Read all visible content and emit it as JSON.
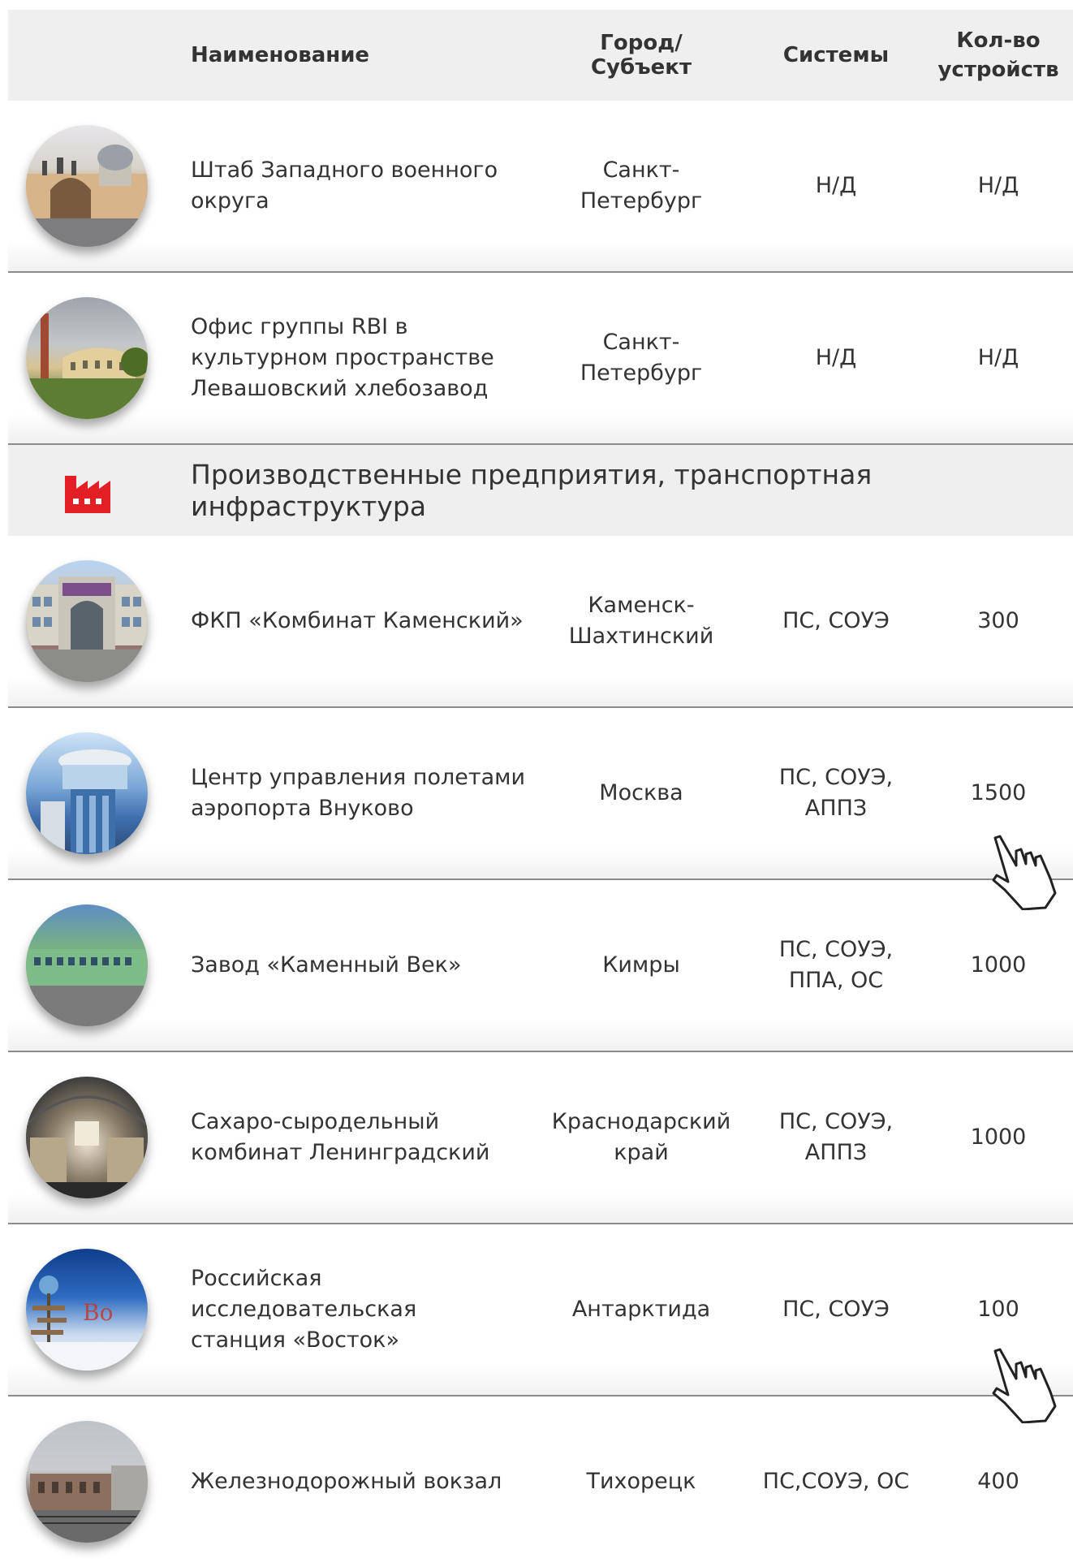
{
  "header": {
    "name": "Наименование",
    "city": "Город/Субъект",
    "systems": "Системы",
    "count_line1": "Кол-во",
    "count_line2": "устройств"
  },
  "rows_top": [
    {
      "name": "Штаб Западного военного округа",
      "city": "Санкт-Петербург",
      "systems": "Н/Д",
      "count": "Н/Д"
    },
    {
      "name_lines": [
        "Офис группы RBI в",
        "культурном пространстве",
        "Левашовский хлебозавод"
      ],
      "city": "Санкт-Петербург",
      "systems": "Н/Д",
      "count": "Н/Д"
    }
  ],
  "section": {
    "title": "Производственные предприятия, транспортная инфраструктура",
    "icon": "factory-icon",
    "icon_color": "#e31e24"
  },
  "rows": [
    {
      "name": "ФКП «Комбинат Каменский»",
      "city_lines": [
        "Каменск-",
        "Шахтинский"
      ],
      "systems_lines": [
        "ПС, СОУЭ"
      ],
      "count": "300"
    },
    {
      "name_lines": [
        "Центр управления полетами",
        "аэропорта Внуково"
      ],
      "city_lines": [
        "Москва"
      ],
      "systems_lines": [
        "ПС, СОУЭ,",
        "АППЗ"
      ],
      "count": "1500"
    },
    {
      "name_lines": [
        "Завод «Каменный Век»"
      ],
      "city_lines": [
        "Кимры"
      ],
      "systems_lines": [
        "ПС, СОУЭ,",
        "ППА, ОС"
      ],
      "count": "1000"
    },
    {
      "name_lines": [
        "Сахаро-сыродельный",
        "комбинат Ленинградский"
      ],
      "city_lines": [
        "Краснодарский",
        "край"
      ],
      "systems_lines": [
        "ПС, СОУЭ,",
        "АППЗ"
      ],
      "count": "1000"
    },
    {
      "name_lines": [
        "Российская исследовательская",
        "станция «Восток»"
      ],
      "city_lines": [
        "Антарктида"
      ],
      "systems_lines": [
        "ПС, СОУЭ"
      ],
      "count": "100"
    },
    {
      "name_lines": [
        "Железнодорожный вокзал"
      ],
      "city_lines": [
        "Тихорецк"
      ],
      "systems_lines": [
        "ПС,СОУЭ, ОС"
      ],
      "count": "400"
    }
  ],
  "cursor_icon": "hand-pointer-icon"
}
